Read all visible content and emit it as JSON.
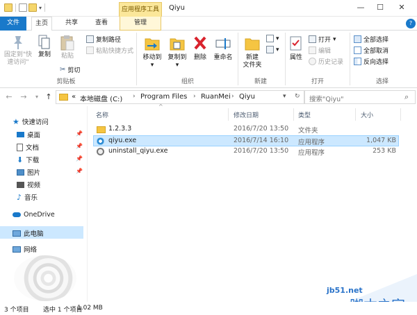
{
  "window": {
    "title": "Qiyu",
    "context_tab": "应用程序工具",
    "controls": {
      "minimize": "—",
      "maximize": "☐",
      "close": "✕"
    }
  },
  "ribbon_tabs": {
    "file": "文件",
    "home": "主页",
    "share": "共享",
    "view": "查看",
    "manage": "管理",
    "help": "?"
  },
  "ribbon": {
    "clipboard": {
      "label": "剪贴板",
      "pin": "固定到\"快\n速访问\"",
      "copy": "复制",
      "paste": "粘贴",
      "copy_path": "复制路径",
      "paste_shortcut": "粘贴快捷方式",
      "cut": "剪切"
    },
    "organize": {
      "label": "组织",
      "move_to": "移动到",
      "copy_to": "复制到",
      "delete": "删除",
      "rename": "重命名"
    },
    "new": {
      "label": "新建",
      "new_folder": "新建\n文件夹"
    },
    "open": {
      "label": "打开",
      "properties": "属性",
      "open": "打开",
      "edit": "编辑",
      "history": "历史记录"
    },
    "select": {
      "label": "选择",
      "select_all": "全部选择",
      "select_none": "全部取消",
      "invert": "反向选择"
    }
  },
  "address": {
    "prefix": "«",
    "crumbs": [
      "本地磁盘 (C:)",
      "Program Files",
      "RuanMei",
      "Qiyu"
    ],
    "search_placeholder": "搜索\"Qiyu\""
  },
  "nav": {
    "quick_access": "快速访问",
    "desktop": "桌面",
    "documents": "文档",
    "downloads": "下载",
    "pictures": "图片",
    "videos": "视频",
    "music": "音乐",
    "onedrive": "OneDrive",
    "this_pc": "此电脑",
    "network": "网络"
  },
  "columns": {
    "name": "名称",
    "modified": "修改日期",
    "type": "类型",
    "size": "大小"
  },
  "files": [
    {
      "name": "1.2.3.3",
      "modified": "2016/7/20 13:50",
      "type": "文件夹",
      "size": "",
      "icon": "folder-icon",
      "selected": false
    },
    {
      "name": "qiyu.exe",
      "modified": "2016/7/14 16:10",
      "type": "应用程序",
      "size": "1,047 KB",
      "icon": "qiyu-app-icon",
      "selected": true
    },
    {
      "name": "uninstall_qiyu.exe",
      "modified": "2016/7/20 13:50",
      "type": "应用程序",
      "size": "253 KB",
      "icon": "uninstall-app-icon",
      "selected": false
    }
  ],
  "status": {
    "count": "3 个项目",
    "selected": "选中 1 个项目",
    "size": "1.02 MB"
  },
  "watermark": {
    "site": "jb51.net",
    "cn": "脚本之家"
  },
  "colors": {
    "accent": "#1979ca",
    "context": "#fbe79a",
    "selection": "#cce8ff"
  }
}
